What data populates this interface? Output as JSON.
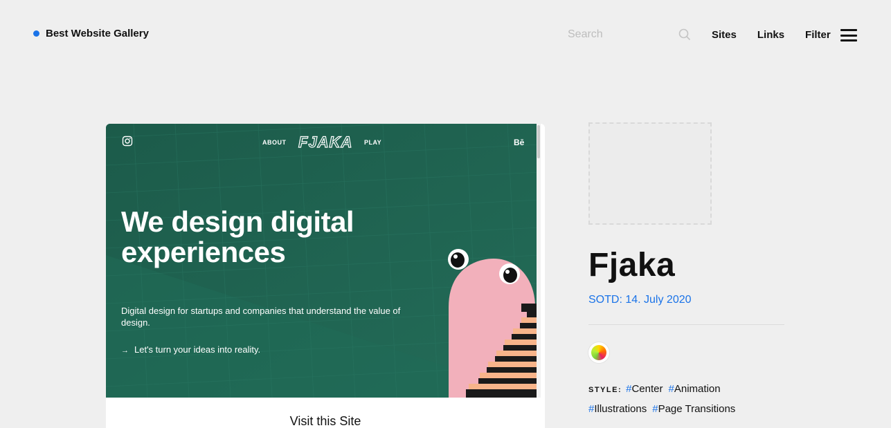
{
  "header": {
    "brand": "Best Website Gallery",
    "search_placeholder": "Search",
    "nav": {
      "sites": "Sites",
      "links": "Links",
      "filter": "Filter"
    }
  },
  "preview": {
    "nav_about": "ABOUT",
    "logo": "FJAKA",
    "nav_play": "PLAY",
    "behance": "Bē",
    "headline": "We design digital experiences",
    "subtext": "Digital design for startups and companies that understand the value of design.",
    "cta": "Let's turn your ideas into reality.",
    "visit_label": "Visit this Site"
  },
  "site": {
    "title": "Fjaka",
    "sotd": "SOTD: 14. July 2020"
  },
  "style": {
    "label": "STYLE:",
    "tags": [
      "Center",
      "Animation",
      "Illustrations",
      "Page Transitions"
    ],
    "hash": "#"
  },
  "colors": {
    "accent": "#1a73e8",
    "shot_bg": "#1f6452",
    "creature": "#f2b0bb",
    "stairs": "#f7b48a"
  }
}
